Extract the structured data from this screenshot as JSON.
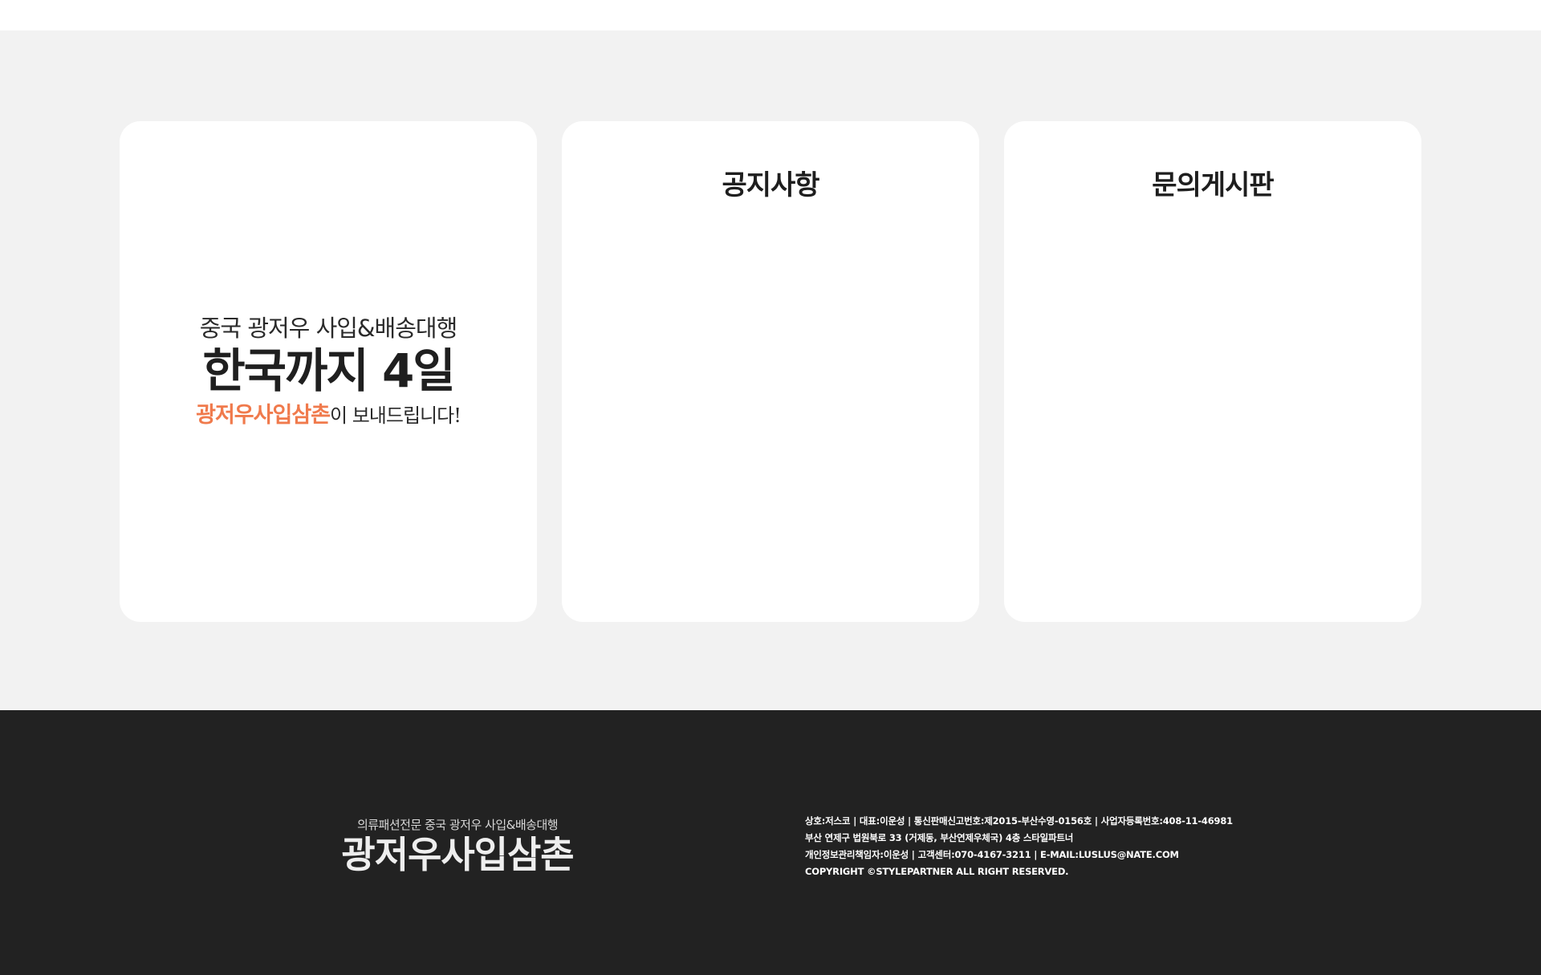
{
  "promo": {
    "subtitle": "중국 광저우 사입&배송대행",
    "headline": "한국까지 4일",
    "brand": "광저우사입삼촌",
    "tail": "이 보내드립니다!",
    "brand_color": "#f07a4c"
  },
  "notice_board": {
    "title": "공지사항"
  },
  "inquiry_board": {
    "title": "문의게시판"
  },
  "footer": {
    "tagline": "의류패션전문 중국 광저우 사입&배송대행",
    "brand": "광저우사입삼촌",
    "info_lines": [
      "상호:저스코 | 대표:이운성 | 통신판매신고번호:제2015-부산수영-0156호 | 사업자등록번호:408-11-46981",
      "부산 연제구 법원북로 33 (거제동, 부산연제우체국) 4층 스타일파트너",
      "개인정보관리책임자:이운성 | 고객센터:070-4167-3211 | E-MAIL:LUSLUS@NATE.COM",
      "COPYRIGHT ©STYLEPARTNER ALL RIGHT RESERVED."
    ],
    "background_color": "#222222"
  },
  "colors": {
    "page_background": "#f2f2f2",
    "card_background": "#ffffff"
  }
}
